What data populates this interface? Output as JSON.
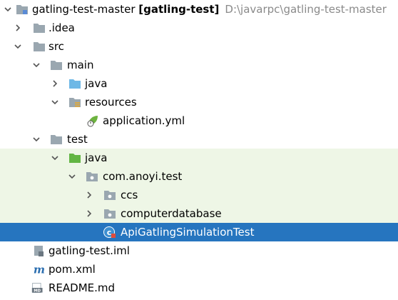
{
  "tree": {
    "root": {
      "name": "gatling-test-master",
      "module": "[gatling-test]",
      "path": "D:\\javarpc\\gatling-test-master"
    },
    "items": [
      {
        "label": ".idea",
        "icon": "folder-icon",
        "arrow": "collapsed"
      },
      {
        "label": "src",
        "icon": "folder-icon",
        "arrow": "expanded"
      },
      {
        "label": "main",
        "icon": "folder-icon",
        "arrow": "expanded"
      },
      {
        "label": "java",
        "icon": "source-folder-icon",
        "arrow": "collapsed"
      },
      {
        "label": "resources",
        "icon": "resources-folder-icon",
        "arrow": "expanded"
      },
      {
        "label": "application.yml",
        "icon": "spring-yml-icon",
        "arrow": "none"
      },
      {
        "label": "test",
        "icon": "folder-icon",
        "arrow": "expanded"
      },
      {
        "label": "java",
        "icon": "test-source-folder-icon",
        "arrow": "expanded"
      },
      {
        "label": "com.anoyi.test",
        "icon": "package-icon",
        "arrow": "expanded"
      },
      {
        "label": "ccs",
        "icon": "package-icon",
        "arrow": "collapsed"
      },
      {
        "label": "computerdatabase",
        "icon": "package-icon",
        "arrow": "collapsed"
      },
      {
        "label": "ApiGatlingSimulationTest",
        "icon": "scala-class-icon",
        "arrow": "none"
      },
      {
        "label": "gatling-test.iml",
        "icon": "iml-file-icon",
        "arrow": "none"
      },
      {
        "label": "pom.xml",
        "icon": "maven-icon",
        "arrow": "none"
      },
      {
        "label": "README.md",
        "icon": "markdown-icon",
        "arrow": "none"
      }
    ]
  },
  "colors": {
    "selection": "#2675bf",
    "test_highlight": "#eef6e6",
    "folder": "#9aa7b0",
    "source_folder": "#6eb8e6",
    "test_folder": "#62b543",
    "path_text": "#8a8a8a"
  }
}
